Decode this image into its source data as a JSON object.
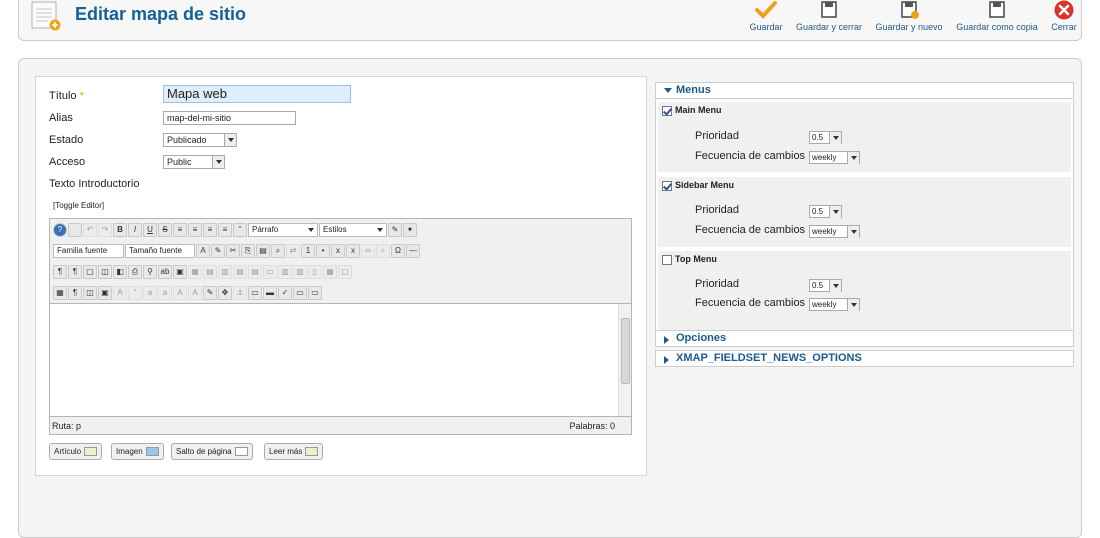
{
  "header": {
    "title": "Editar mapa de sitio",
    "buttons": [
      {
        "label": "Guardar",
        "icon": "check-icon"
      },
      {
        "label": "Guardar y cerrar",
        "icon": "save-close-icon"
      },
      {
        "label": "Guardar y nuevo",
        "icon": "save-new-icon"
      },
      {
        "label": "Guardar como copia",
        "icon": "save-copy-icon"
      },
      {
        "label": "Cerrar",
        "icon": "close-icon"
      }
    ]
  },
  "form": {
    "title_label": "Título",
    "title_required": "*",
    "title_value": "Mapa web",
    "alias_label": "Alias",
    "alias_value": "map-del-mi-sitio",
    "state_label": "Estado",
    "state_value": "Publicado",
    "access_label": "Acceso",
    "access_value": "Public",
    "intro_label": "Texto Introductorio",
    "toggle_editor": "[Toggle Editor]"
  },
  "editor": {
    "format_select": "Párrafo",
    "styles_select": "Estilos",
    "font_family_select": "Familia fuente",
    "font_size_select": "Tamaño fuente",
    "path_label": "Ruta: p",
    "words_label": "Palabras: 0",
    "buttons_row1": [
      "B",
      "I",
      "U",
      "S"
    ],
    "bottom_buttons": [
      "Artículo",
      "Imagen",
      "Salto de página",
      "Leer más"
    ]
  },
  "sidebar": {
    "menus_title": "Menus",
    "menus": [
      {
        "name": "Main Menu",
        "checked": true,
        "priority_label": "Prioridad",
        "priority": "0.5",
        "freq_label": "Fecuencia de cambios",
        "freq": "weekly"
      },
      {
        "name": "Sidebar Menu",
        "checked": true,
        "priority_label": "Prioridad",
        "priority": "0.5",
        "freq_label": "Fecuencia de cambios",
        "freq": "weekly"
      },
      {
        "name": "Top Menu",
        "checked": false,
        "priority_label": "Prioridad",
        "priority": "0.5",
        "freq_label": "Fecuencia de cambios",
        "freq": "weekly"
      }
    ],
    "options_title": "Opciones",
    "news_title": "XMAP_FIELDSET_NEWS_OPTIONS"
  },
  "colors": {
    "title_blue": "#146295",
    "link_blue": "#1b5a8a",
    "check_orange": "#f0a020",
    "close_red": "#d9332b"
  }
}
